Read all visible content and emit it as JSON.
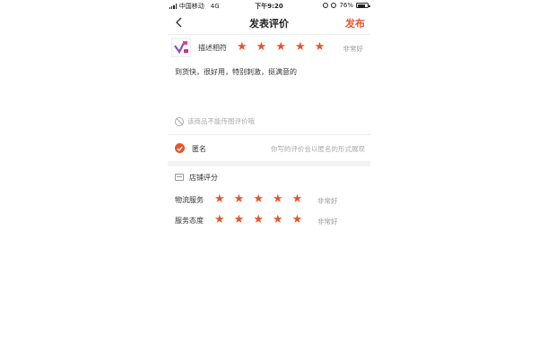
{
  "status_bar": {
    "carrier": "中国移动",
    "network": "4G",
    "time": "下午9:20",
    "battery_percent": "76%",
    "battery_level": 0.76
  },
  "nav": {
    "back_icon": "chevron-left-icon",
    "title": "发表评价",
    "publish_label": "发布"
  },
  "product_rating": {
    "label": "描述相符",
    "stars": 5,
    "rating_text": "非常好"
  },
  "review": {
    "text": "到货快，很好用，特别刺激，挺满意的"
  },
  "photo_notice": {
    "text": "该商品不能传图评价哦"
  },
  "anonymous": {
    "checked": true,
    "label": "匿名",
    "hint": "你写的评价会以匿名的形式展现"
  },
  "shop_scores": {
    "header": "店铺评分",
    "items": [
      {
        "label": "物流服务",
        "stars": 5,
        "rating_text": "非常好"
      },
      {
        "label": "服务态度",
        "stars": 5,
        "rating_text": "非常好"
      }
    ]
  },
  "colors": {
    "accent": "#e8542b",
    "muted": "#999999"
  }
}
